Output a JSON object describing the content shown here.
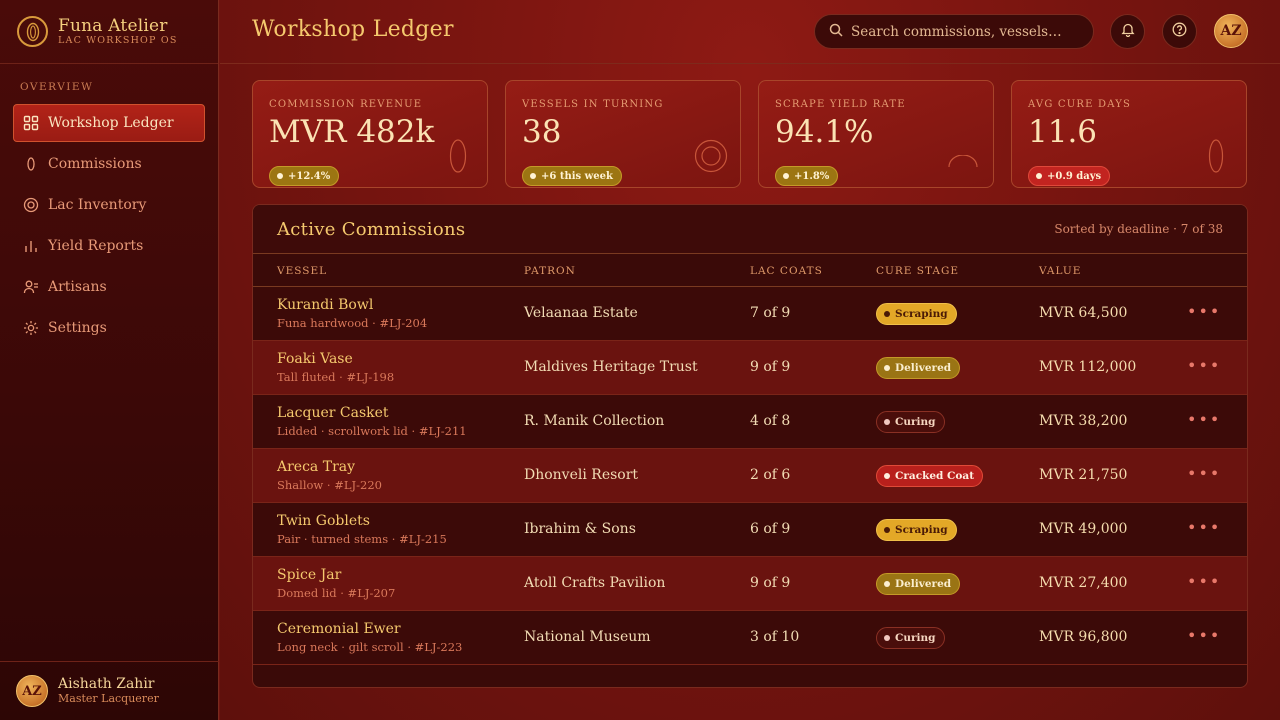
{
  "brand": {
    "title": "Funa Atelier",
    "subtitle": "LAC WORKSHOP OS"
  },
  "sidebar": {
    "section": "OVERVIEW",
    "items": [
      {
        "label": "Workshop Ledger",
        "icon": "grid-icon",
        "active": true
      },
      {
        "label": "Commissions",
        "icon": "leaf-icon"
      },
      {
        "label": "Lac Inventory",
        "icon": "target-icon"
      },
      {
        "label": "Yield Reports",
        "icon": "bar-chart-icon"
      },
      {
        "label": "Artisans",
        "icon": "users-icon"
      },
      {
        "label": "Settings",
        "icon": "gear-icon"
      }
    ],
    "user": {
      "initials": "AZ",
      "name": "Aishath Zahir",
      "role": "Master Lacquerer"
    }
  },
  "header": {
    "title": "Workshop Ledger",
    "search_placeholder": "Search commissions, vessels…",
    "avatar_initials": "AZ"
  },
  "kpis": [
    {
      "label": "COMMISSION REVENUE",
      "value": "MVR 482k",
      "badge": "+12.4%",
      "tone": "gold"
    },
    {
      "label": "VESSELS IN TURNING",
      "value": "38",
      "badge": "+6 this week",
      "tone": "gold"
    },
    {
      "label": "SCRAPE YIELD RATE",
      "value": "94.1%",
      "badge": "+1.8%",
      "tone": "gold"
    },
    {
      "label": "AVG CURE DAYS",
      "value": "11.6",
      "badge": "+0.9 days",
      "tone": "red"
    }
  ],
  "table": {
    "title": "Active Commissions",
    "meta": "Sorted by deadline · 7 of 38",
    "columns": {
      "vessel": "VESSEL",
      "patron": "PATRON",
      "coats": "LAC COATS",
      "stage": "CURE STAGE",
      "value": "VALUE"
    },
    "rows": [
      {
        "name": "Kurandi Bowl",
        "sub": "Funa hardwood · #LJ-204",
        "patron": "Velaanaa Estate",
        "coats": "7 of 9",
        "stage": "Scraping",
        "stage_class": "st-scraping",
        "value": "MVR 64,500"
      },
      {
        "name": "Foaki Vase",
        "sub": "Tall fluted · #LJ-198",
        "patron": "Maldives Heritage Trust",
        "coats": "9 of 9",
        "stage": "Delivered",
        "stage_class": "st-delivered",
        "value": "MVR 112,000"
      },
      {
        "name": "Lacquer Casket",
        "sub": "Lidded · scrollwork lid · #LJ-211",
        "patron": "R. Manik Collection",
        "coats": "4 of 8",
        "stage": "Curing",
        "stage_class": "st-curing",
        "value": "MVR 38,200"
      },
      {
        "name": "Areca Tray",
        "sub": "Shallow · #LJ-220",
        "patron": "Dhonveli Resort",
        "coats": "2 of 6",
        "stage": "Cracked Coat",
        "stage_class": "st-cracked",
        "value": "MVR 21,750"
      },
      {
        "name": "Twin Goblets",
        "sub": "Pair · turned stems · #LJ-215",
        "patron": "Ibrahim & Sons",
        "coats": "6 of 9",
        "stage": "Scraping",
        "stage_class": "st-scraping",
        "value": "MVR 49,000"
      },
      {
        "name": "Spice Jar",
        "sub": "Domed lid · #LJ-207",
        "patron": "Atoll Crafts Pavilion",
        "coats": "9 of 9",
        "stage": "Delivered",
        "stage_class": "st-delivered",
        "value": "MVR 27,400"
      },
      {
        "name": "Ceremonial Ewer",
        "sub": "Long neck · gilt scroll · #LJ-223",
        "patron": "National Museum",
        "coats": "3 of 10",
        "stage": "Curing",
        "stage_class": "st-curing",
        "value": "MVR 96,800"
      }
    ],
    "more_label": "•••"
  },
  "colors": {
    "accent_gold": "#f5c96e",
    "brand_red": "#b22318",
    "bg": "#6e1410"
  }
}
